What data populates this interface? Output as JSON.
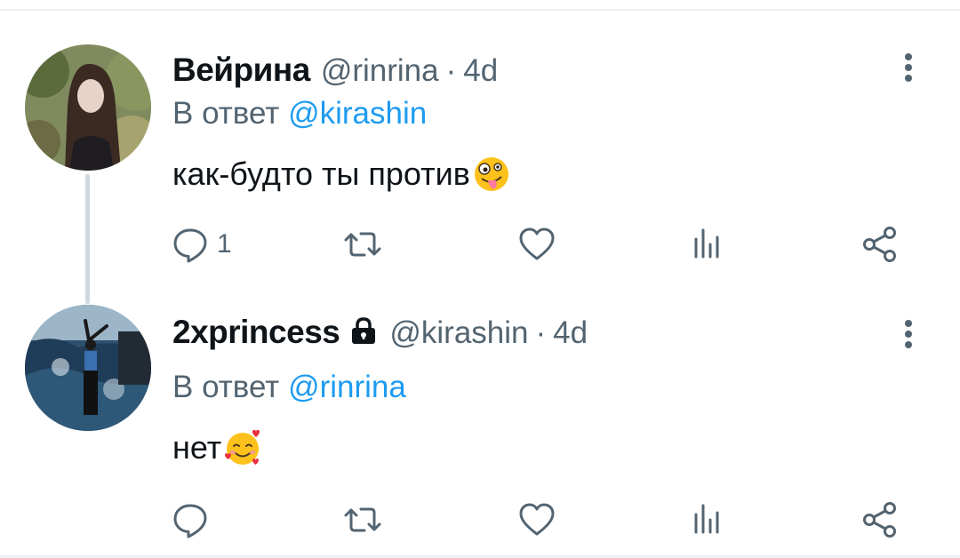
{
  "tweets": [
    {
      "display_name": "Вейрина",
      "handle": "@rinrina",
      "separator": "·",
      "time": "4d",
      "reply_prefix": "В ответ ",
      "reply_mention": "@kirashin",
      "text": "как-будто ты против",
      "emoji": "zany-face-emoji",
      "reply_count": "1",
      "locked": false
    },
    {
      "display_name": "2xprincess",
      "handle": "@kirashin",
      "separator": "·",
      "time": "4d",
      "reply_prefix": "В ответ ",
      "reply_mention": "@rinrina",
      "text": "нет",
      "emoji": "smiling-face-with-hearts-emoji",
      "reply_count": "",
      "locked": true
    }
  ],
  "colors": {
    "text": "#0f1419",
    "secondary": "#536471",
    "link": "#1d9bf0",
    "thread_line": "#cfd9de"
  },
  "icons": [
    "reply-icon",
    "retweet-icon",
    "like-icon",
    "stats-icon",
    "share-icon",
    "more-icon",
    "lock-icon"
  ]
}
